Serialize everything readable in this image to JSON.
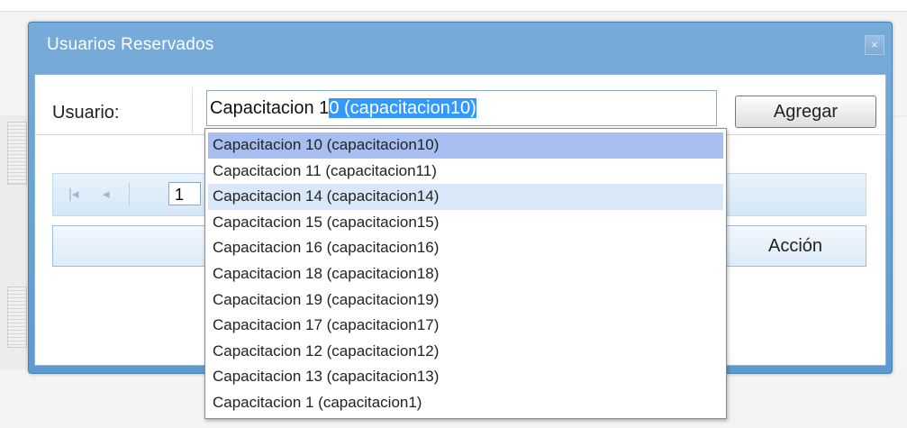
{
  "window": {
    "title": "Usuarios Reservados",
    "close_glyph": "×"
  },
  "toolbar": {
    "usuario_label": "Usuario:",
    "input_typed": "Capacitacion 1",
    "input_autocomplete": "0  (capacitacion10)",
    "agregar_label": "Agregar"
  },
  "pager": {
    "first_glyph": "|◂",
    "prev_glyph": "◂",
    "page_value": "1"
  },
  "grid": {
    "accion_header": "Acción"
  },
  "dropdown": {
    "items": [
      "Capacitacion 10  (capacitacion10)",
      "Capacitacion 11  (capacitacion11)",
      "Capacitacion 14  (capacitacion14)",
      "Capacitacion 15  (capacitacion15)",
      "Capacitacion 16  (capacitacion16)",
      "Capacitacion 18  (capacitacion18)",
      "Capacitacion 19  (capacitacion19)",
      "Capacitacion 17  (capacitacion17)",
      "Capacitacion 12  (capacitacion12)",
      "Capacitacion 13  (capacitacion13)",
      "Capacitacion 1  (capacitacion1)"
    ],
    "selected_index": 0,
    "hover_index": 2
  },
  "colors": {
    "window_header": "#6ea3d5",
    "selection_highlight": "#3399ff",
    "selected_item": "#a8bdf0",
    "hover_item": "#d8e8f8"
  }
}
